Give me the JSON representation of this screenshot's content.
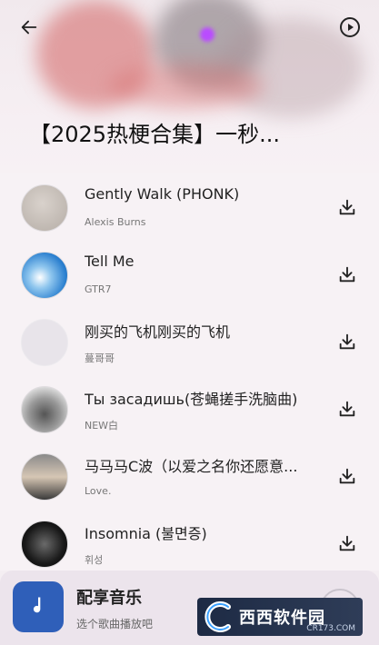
{
  "header": {
    "title": "【2025热梗合集】一秒..."
  },
  "songs": [
    {
      "name": "Gently Walk (PHONK)",
      "artist": "Alexis Burns"
    },
    {
      "name": "Tell Me",
      "artist": "GTR7"
    },
    {
      "name": "刚买的飞机刚买的飞机",
      "artist": "蔓哥哥"
    },
    {
      "name": "Ты засадишь(苍蝇搓手洗脑曲)",
      "artist": "NEW白"
    },
    {
      "name": "马马马C波（以爱之名你还愿意...",
      "artist": "Love."
    },
    {
      "name": "Insomnia (불면증)",
      "artist": "휘성"
    }
  ],
  "player": {
    "title": "配享音乐",
    "subtitle": "选个歌曲播放吧"
  },
  "watermark": {
    "name": "西西软件园",
    "domain": "CR173.COM"
  },
  "icons": [
    "back-arrow-icon",
    "play-circle-icon",
    "download-icon",
    "music-note-icon"
  ],
  "colors": {
    "accent": "#2f5fb9"
  }
}
